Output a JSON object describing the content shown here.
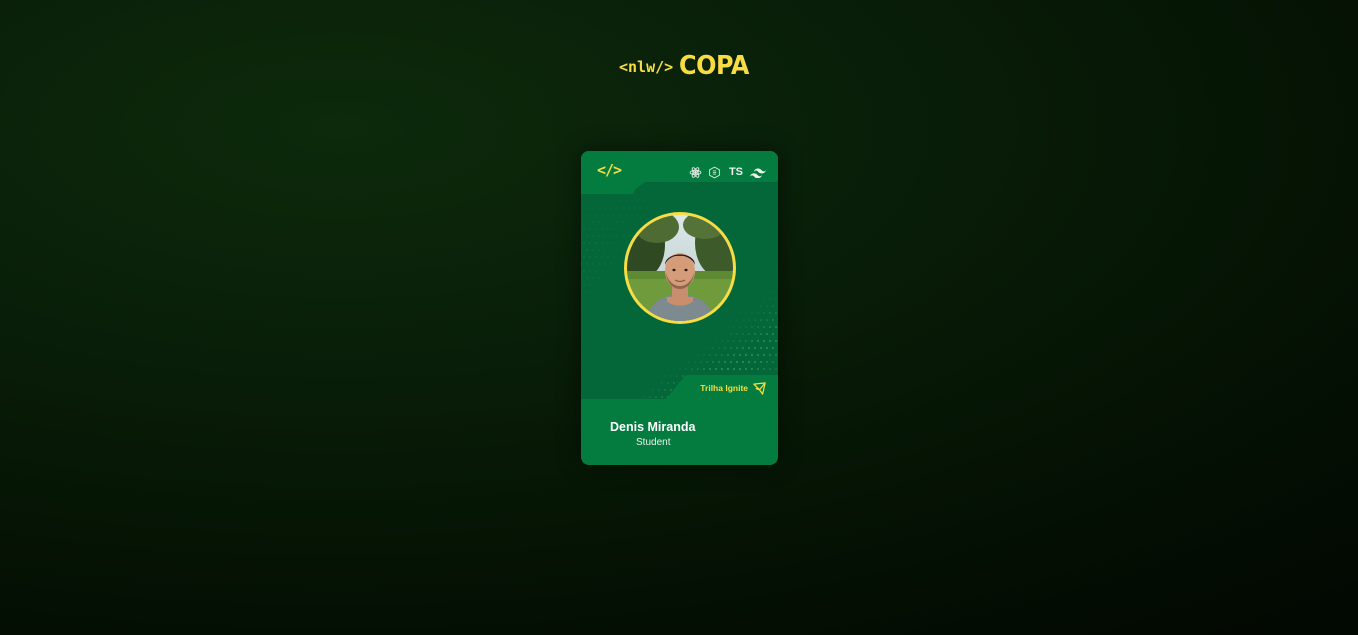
{
  "logo": {
    "prefix": "<nlw/>",
    "title": "COPA"
  },
  "card": {
    "code_symbol": "</>",
    "tech_stack": [
      {
        "name": "react-icon"
      },
      {
        "name": "nodejs-icon"
      },
      {
        "name": "ts-icon",
        "label": "TS"
      },
      {
        "name": "tailwind-icon"
      }
    ],
    "track_label": "Trilha Ignite",
    "track_icon": "rocket-icon",
    "name": "Denis Miranda",
    "role": "Student"
  },
  "colors": {
    "accent_yellow": "#f7dd43",
    "card_green": "#047c3f",
    "card_dark_green": "#04673a",
    "background": "#081c07"
  }
}
